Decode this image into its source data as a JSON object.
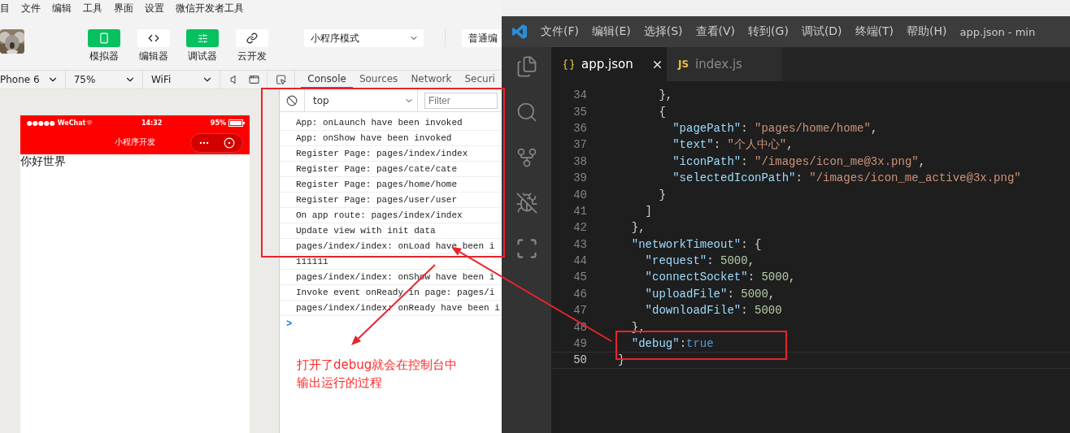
{
  "menu_bar": {
    "items": [
      "目",
      "文件",
      "编辑",
      "工具",
      "界面",
      "设置",
      "微信开发者工具"
    ]
  },
  "toolbar": {
    "buttons": [
      {
        "label": "模拟器",
        "kind": "phone",
        "selected": true
      },
      {
        "label": "编辑器",
        "kind": "code",
        "selected": false
      },
      {
        "label": "调试器",
        "kind": "sliders",
        "selected": true
      },
      {
        "label": "云开发",
        "kind": "link",
        "selected": false
      }
    ],
    "mode_select": "小程序模式",
    "compile_select": "普通编"
  },
  "device_bar": {
    "device": "Phone 6",
    "zoom": "75%",
    "network": "WiFi",
    "tabs": [
      {
        "label": "Console",
        "selected": true
      },
      {
        "label": "Sources",
        "selected": false
      },
      {
        "label": "Network",
        "selected": false
      },
      {
        "label": "Securi",
        "selected": false
      }
    ]
  },
  "simulator": {
    "carrier": "●●●●● WeChat",
    "time": "14:32",
    "battery": "95%",
    "nav_title": "小程序开发",
    "body_text": "你好世界"
  },
  "console": {
    "context": "top",
    "filter_placeholder": "Filter",
    "logs": [
      "App: onLaunch have been invoked",
      "App: onShow have been invoked",
      "Register Page: pages/index/index",
      "Register Page: pages/cate/cate",
      "Register Page: pages/home/home",
      "Register Page: pages/user/user",
      "On app route: pages/index/index",
      "Update view with init data",
      "pages/index/index: onLoad have been i",
      "111111",
      "pages/index/index: onShow have been i",
      "Invoke event onReady in page: pages/i",
      "pages/index/index: onReady have been i"
    ],
    "prompt": ">"
  },
  "editor": {
    "menus": [
      "文件(F)",
      "编辑(E)",
      "选择(S)",
      "查看(V)",
      "转到(G)",
      "调试(D)",
      "终端(T)",
      "帮助(H)"
    ],
    "window_title": "app.json - min",
    "tabs": [
      {
        "label": "app.json",
        "kind": "json",
        "selected": true
      },
      {
        "label": "index.js",
        "kind": "js",
        "badge": "JS",
        "selected": false
      }
    ],
    "lines": [
      {
        "number": "34",
        "tokens": [
          {
            "kind": "punct",
            "text": "      },"
          }
        ]
      },
      {
        "number": "35",
        "tokens": [
          {
            "kind": "punct",
            "text": "      {"
          }
        ]
      },
      {
        "number": "36",
        "tokens": [
          {
            "kind": "key",
            "text": "        \"pagePath\""
          },
          {
            "kind": "punct",
            "text": ": "
          },
          {
            "kind": "string",
            "text": "\"pages/home/home\""
          },
          {
            "kind": "punct",
            "text": ","
          }
        ]
      },
      {
        "number": "37",
        "tokens": [
          {
            "kind": "key",
            "text": "        \"text\""
          },
          {
            "kind": "punct",
            "text": ": "
          },
          {
            "kind": "string",
            "text": "\"个人中心\""
          },
          {
            "kind": "punct",
            "text": ","
          }
        ]
      },
      {
        "number": "38",
        "tokens": [
          {
            "kind": "key",
            "text": "        \"iconPath\""
          },
          {
            "kind": "punct",
            "text": ": "
          },
          {
            "kind": "string",
            "text": "\"/images/icon_me@3x.png\""
          },
          {
            "kind": "punct",
            "text": ","
          }
        ]
      },
      {
        "number": "39",
        "tokens": [
          {
            "kind": "key",
            "text": "        \"selectedIconPath\""
          },
          {
            "kind": "punct",
            "text": ": "
          },
          {
            "kind": "string",
            "text": "\"/images/icon_me_active@3x.png\""
          }
        ]
      },
      {
        "number": "40",
        "tokens": [
          {
            "kind": "punct",
            "text": "      }"
          }
        ]
      },
      {
        "number": "41",
        "tokens": [
          {
            "kind": "punct",
            "text": "    ]"
          }
        ]
      },
      {
        "number": "42",
        "tokens": [
          {
            "kind": "punct",
            "text": "  },"
          }
        ]
      },
      {
        "number": "43",
        "tokens": [
          {
            "kind": "key",
            "text": "  \"networkTimeout\""
          },
          {
            "kind": "punct",
            "text": ": {"
          }
        ]
      },
      {
        "number": "44",
        "tokens": [
          {
            "kind": "key",
            "text": "    \"request\""
          },
          {
            "kind": "punct",
            "text": ": "
          },
          {
            "kind": "number",
            "text": "5000"
          },
          {
            "kind": "punct",
            "text": ","
          }
        ]
      },
      {
        "number": "45",
        "tokens": [
          {
            "kind": "key",
            "text": "    \"connectSocket\""
          },
          {
            "kind": "punct",
            "text": ": "
          },
          {
            "kind": "number",
            "text": "5000"
          },
          {
            "kind": "punct",
            "text": ","
          }
        ]
      },
      {
        "number": "46",
        "tokens": [
          {
            "kind": "key",
            "text": "    \"uploadFile\""
          },
          {
            "kind": "punct",
            "text": ": "
          },
          {
            "kind": "number",
            "text": "5000"
          },
          {
            "kind": "punct",
            "text": ","
          }
        ]
      },
      {
        "number": "47",
        "tokens": [
          {
            "kind": "key",
            "text": "    \"downloadFile\""
          },
          {
            "kind": "punct",
            "text": ": "
          },
          {
            "kind": "number",
            "text": "5000"
          }
        ]
      },
      {
        "number": "48",
        "tokens": [
          {
            "kind": "punct",
            "text": "  },"
          }
        ]
      },
      {
        "number": "49",
        "tokens": [
          {
            "kind": "key",
            "text": "  \"debug\""
          },
          {
            "kind": "punct",
            "text": ":"
          },
          {
            "kind": "keyword",
            "text": "true"
          }
        ]
      },
      {
        "number": "50",
        "current": true,
        "tokens": [
          {
            "kind": "punct",
            "text": "}"
          }
        ]
      }
    ]
  },
  "annotation": {
    "caption_lines": [
      "打开了debug就会在控制台中",
      "输出运行的过程"
    ]
  }
}
